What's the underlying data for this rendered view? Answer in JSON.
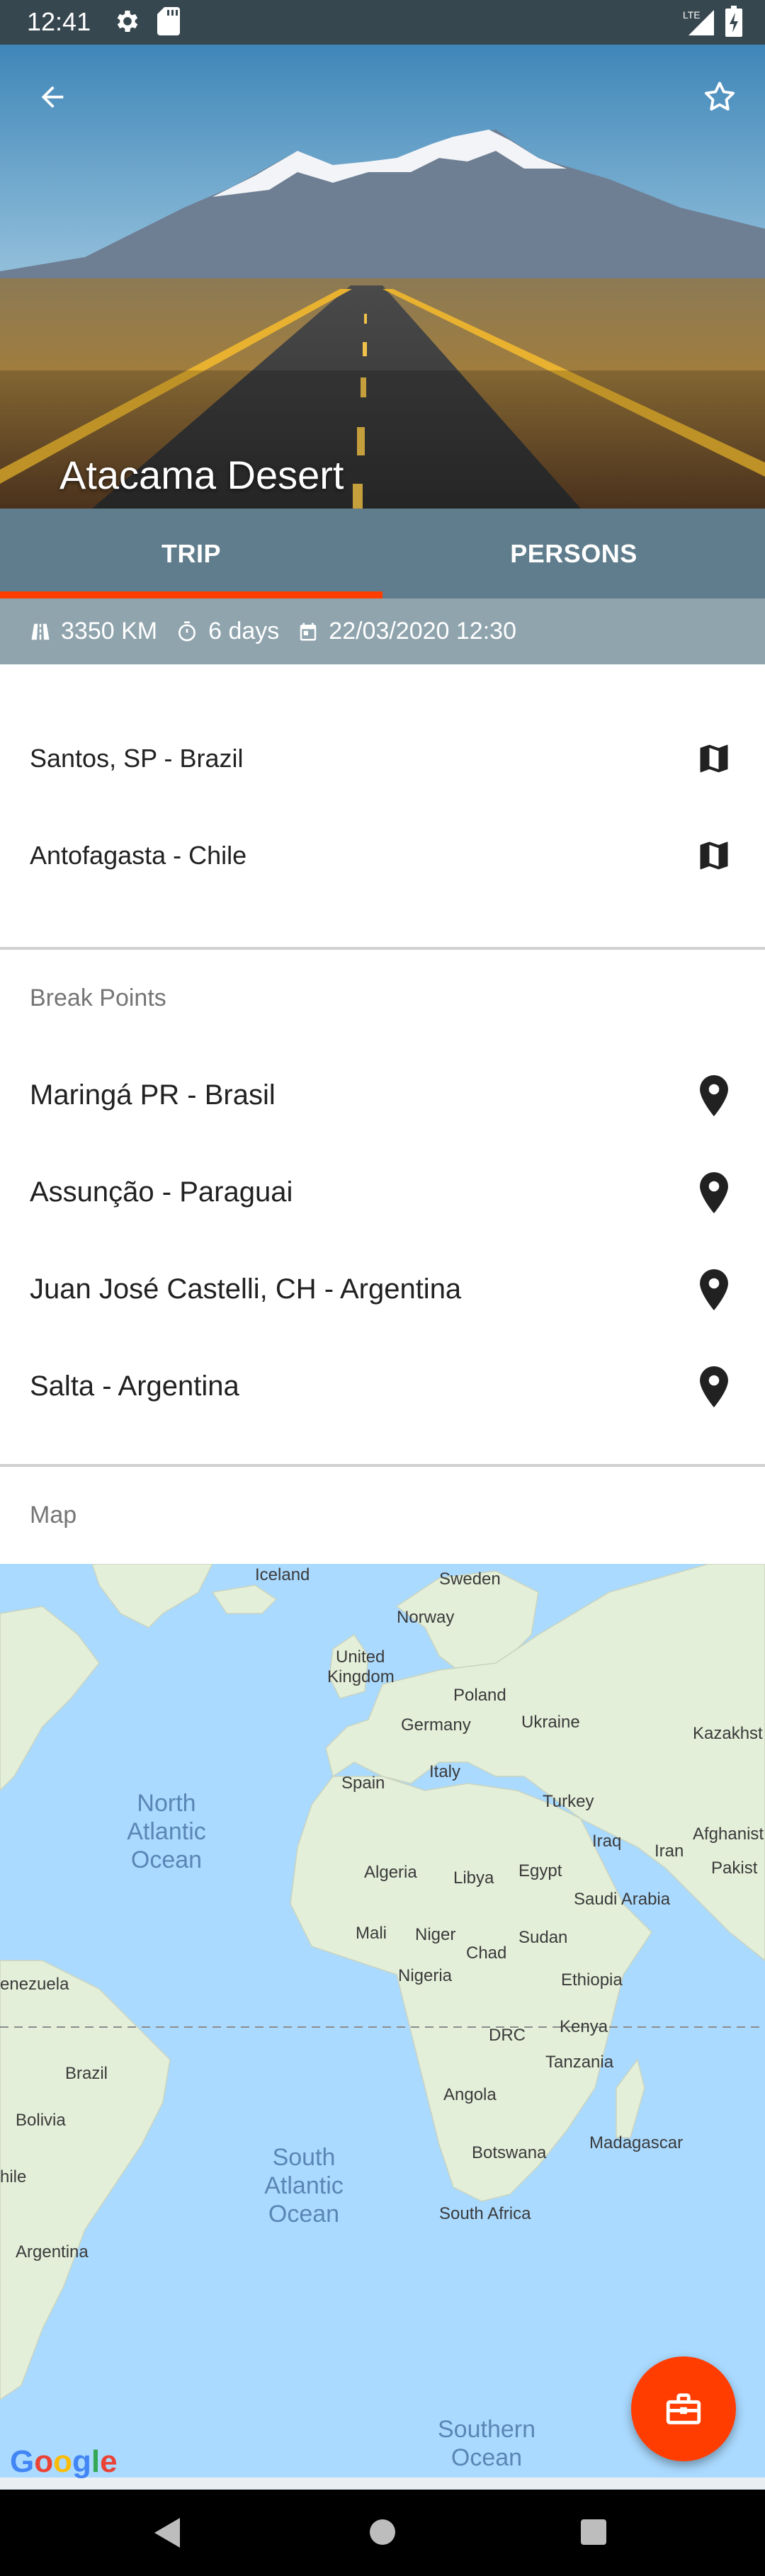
{
  "status_bar": {
    "time": "12:41",
    "network": "LTE",
    "icons": [
      "settings-icon",
      "sd-card-icon",
      "signal-icon",
      "battery-charging-icon"
    ]
  },
  "header": {
    "title": "Atacama Desert",
    "back_icon": "arrow-back-icon",
    "favorite_icon": "star-outline-icon"
  },
  "tabs": [
    {
      "label": "TRIP",
      "active": true
    },
    {
      "label": "PERSONS",
      "active": false
    }
  ],
  "info": {
    "distance": "3350 KM",
    "duration": "6 days",
    "datetime": "22/03/2020 12:30"
  },
  "route": {
    "origin": "Santos, SP - Brazil",
    "destination": "Antofagasta - Chile"
  },
  "break_points": {
    "label": "Break Points",
    "items": [
      "Maringá PR - Brasil",
      "Assunção - Paraguai",
      "Juan José Castelli, CH - Argentina",
      "Salta - Argentina"
    ]
  },
  "map": {
    "label": "Map",
    "places": {
      "iceland": "Iceland",
      "sweden": "Sweden",
      "norway": "Norway",
      "uk1": "United",
      "uk2": "Kingdom",
      "poland": "Poland",
      "germany": "Germany",
      "ukraine": "Ukraine",
      "kazakhstan": "Kazakhst",
      "spain": "Spain",
      "italy": "Italy",
      "turkey": "Turkey",
      "iraq": "Iraq",
      "iran": "Iran",
      "afghanistan": "Afghanist",
      "pakistan": "Pakist",
      "algeria": "Algeria",
      "libya": "Libya",
      "egypt": "Egypt",
      "saudi": "Saudi Arabia",
      "mali": "Mali",
      "niger": "Niger",
      "chad": "Chad",
      "sudan": "Sudan",
      "nigeria": "Nigeria",
      "ethiopia": "Ethiopia",
      "venezuela": "enezuela",
      "drc": "DRC",
      "kenya": "Kenya",
      "tanzania": "Tanzania",
      "brazil": "Brazil",
      "angola": "Angola",
      "bolivia": "Bolivia",
      "botswana": "Botswana",
      "madagascar": "Madagascar",
      "chile": "hile",
      "south_africa": "South Africa",
      "argentina": "Argentina"
    },
    "oceans": {
      "north_atlantic": [
        "North",
        "Atlantic",
        "Ocean"
      ],
      "south_atlantic": [
        "South",
        "Atlantic",
        "Ocean"
      ],
      "southern": [
        "Southern",
        "Ocean"
      ]
    },
    "logo": "Google"
  },
  "fab": {
    "icon": "briefcase-icon"
  },
  "colors": {
    "status_bar": "#37474f",
    "tabs_bg": "#5f7d8c",
    "info_bar": "#90a4ae",
    "accent": "#ff3d00",
    "ocean": "#aadaff",
    "land": "#e4efd9"
  }
}
